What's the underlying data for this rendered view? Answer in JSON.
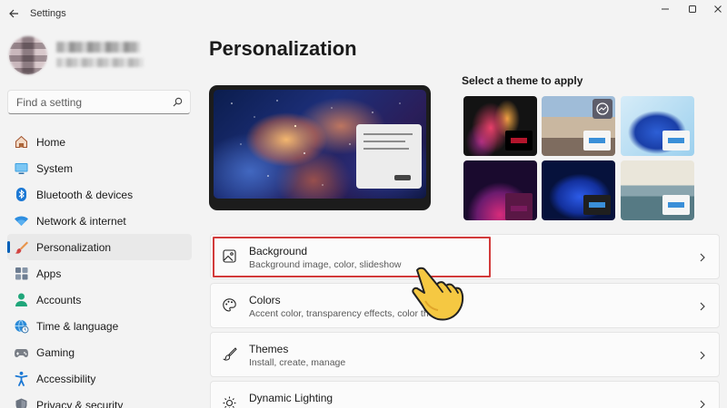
{
  "window": {
    "title": "Settings",
    "controls": [
      "minimize-icon",
      "maximize-icon",
      "close-icon"
    ]
  },
  "sidebar": {
    "search": {
      "placeholder": "Find a setting",
      "value": ""
    },
    "items": [
      {
        "label": "Home",
        "icon": "home-icon",
        "active": false
      },
      {
        "label": "System",
        "icon": "monitor-icon",
        "active": false
      },
      {
        "label": "Bluetooth & devices",
        "icon": "bluetooth-icon",
        "active": false
      },
      {
        "label": "Network & internet",
        "icon": "wifi-icon",
        "active": false
      },
      {
        "label": "Personalization",
        "icon": "brush-icon",
        "active": true
      },
      {
        "label": "Apps",
        "icon": "apps-icon",
        "active": false
      },
      {
        "label": "Accounts",
        "icon": "person-icon",
        "active": false
      },
      {
        "label": "Time & language",
        "icon": "globe-clock-icon",
        "active": false
      },
      {
        "label": "Gaming",
        "icon": "gamepad-icon",
        "active": false
      },
      {
        "label": "Accessibility",
        "icon": "accessibility-icon",
        "active": false
      },
      {
        "label": "Privacy & security",
        "icon": "shield-icon",
        "active": false
      }
    ]
  },
  "main": {
    "title": "Personalization",
    "theme_heading": "Select a theme to apply",
    "themes": [
      {
        "name": "theme-glow",
        "accent": "#b3152c"
      },
      {
        "name": "theme-captured-motion",
        "accent": "#3a8fd8"
      },
      {
        "name": "theme-windows-light",
        "accent": "#3a8fd8"
      },
      {
        "name": "theme-flow",
        "accent": "#6a1b55"
      },
      {
        "name": "theme-windows-dark",
        "accent": "#3a8fd8"
      },
      {
        "name": "theme-sunrise",
        "accent": "#3a8fd8"
      }
    ],
    "cards": [
      {
        "title": "Background",
        "description": "Background image, color, slideshow",
        "icon": "image-icon"
      },
      {
        "title": "Colors",
        "description": "Accent color, transparency effects, color theme",
        "icon": "palette-icon"
      },
      {
        "title": "Themes",
        "description": "Install, create, manage",
        "icon": "brush-icon"
      },
      {
        "title": "Dynamic Lighting",
        "description": "",
        "icon": "sun-icon"
      }
    ]
  },
  "colors": {
    "accent": "#005fb8",
    "highlight": "#d23a3a",
    "cursor": "#f5c842"
  }
}
